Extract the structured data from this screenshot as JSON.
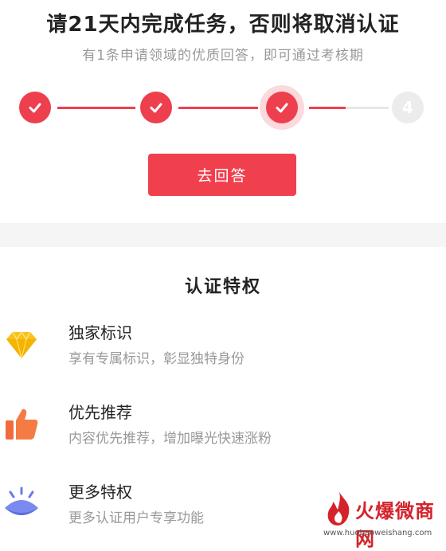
{
  "header": {
    "title": "请21天内完成任务，否则将取消认证",
    "subtitle": "有1条申请领域的优质回答，即可通过考核期"
  },
  "steps": {
    "completed": 3,
    "current": 3,
    "total": 4,
    "last_label": "4"
  },
  "action": {
    "answer_label": "去回答"
  },
  "privileges": {
    "title": "认证特权",
    "items": [
      {
        "name": "独家标识",
        "desc": "享有专属标识，彰显独特身份",
        "icon": "diamond-icon"
      },
      {
        "name": "优先推荐",
        "desc": "内容优先推荐，增加曝光快速涨粉",
        "icon": "thumbs-up-icon"
      },
      {
        "name": "更多特权",
        "desc": "更多认证用户专享功能",
        "icon": "eye-icon"
      }
    ]
  },
  "watermark": {
    "text": "火爆微商网",
    "url": "www.huobaoweishang.com"
  },
  "colors": {
    "accent": "#ee3f4f",
    "muted": "#999999"
  }
}
